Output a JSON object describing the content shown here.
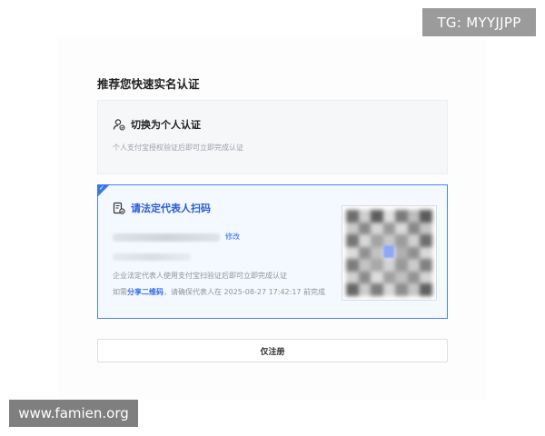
{
  "watermark_top": "TG: MYYJJPP",
  "watermark_bottom": "www.famien.org",
  "page_title": "推荐您快速实名认证",
  "personal_card": {
    "title": "切换为个人认证",
    "description": "个人支付宝授权验证后即可立即完成认证"
  },
  "legal_card": {
    "title": "请法定代表人扫码",
    "edit_label": "修改",
    "description": "企业法定代表人使用支付宝扫验证后即可立即完成认证",
    "share_prefix": "如需",
    "share_link": "分享二维码",
    "share_suffix": "，请确保代表人在 2025-08-27 17:42:17 前完成",
    "qr_icon": "qr-code-blurred"
  },
  "register_button": "仅注册",
  "colors": {
    "accent": "#2f6bf0",
    "card_border": "#4d82f0",
    "card_bg": "#f4f8ff"
  }
}
